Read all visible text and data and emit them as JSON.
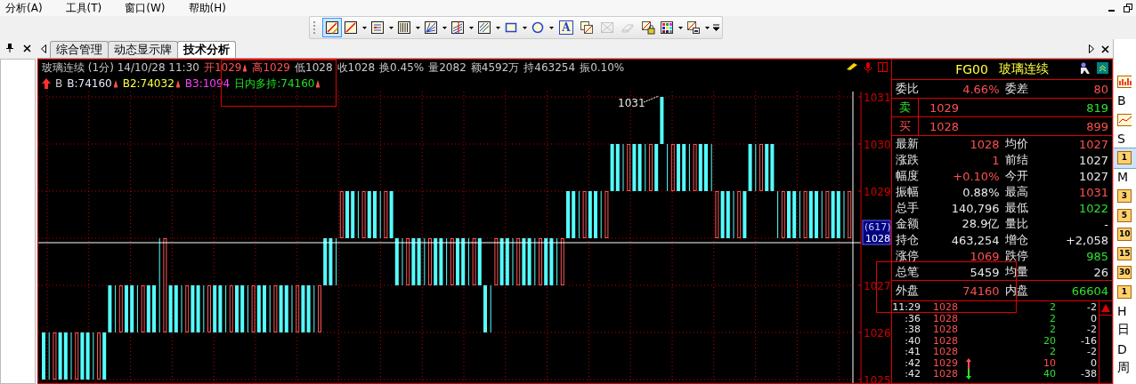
{
  "menu": [
    {
      "label": "分析(A)"
    },
    {
      "label": "工具(T)"
    },
    {
      "label": "窗口(W)"
    },
    {
      "label": "帮助(H)"
    }
  ],
  "toolbar": [
    {
      "kind": "pen",
      "dropdown": false,
      "selected": true,
      "disabled": false
    },
    {
      "kind": "line",
      "dropdown": true,
      "selected": false,
      "disabled": false
    },
    {
      "kind": "text-lines",
      "dropdown": true,
      "selected": false,
      "disabled": false
    },
    {
      "kind": "vertical-lines",
      "dropdown": true,
      "selected": false,
      "disabled": false
    },
    {
      "kind": "fan",
      "dropdown": true,
      "selected": false,
      "disabled": false
    },
    {
      "kind": "parallel",
      "dropdown": true,
      "selected": false,
      "disabled": false
    },
    {
      "kind": "hatch",
      "dropdown": true,
      "selected": false,
      "disabled": false
    },
    {
      "kind": "rectangle",
      "dropdown": true,
      "selected": false,
      "disabled": false
    },
    {
      "kind": "ellipse",
      "dropdown": true,
      "selected": false,
      "disabled": false
    },
    {
      "kind": "letter",
      "label": "A",
      "dropdown": false,
      "selected": false,
      "disabled": false
    },
    {
      "kind": "copy",
      "dropdown": false,
      "selected": false,
      "disabled": false
    },
    {
      "kind": "cross",
      "dropdown": false,
      "selected": false,
      "disabled": true
    },
    {
      "kind": "eraser",
      "dropdown": false,
      "selected": false,
      "disabled": true
    },
    {
      "kind": "lock",
      "dropdown": false,
      "selected": false,
      "disabled": false
    },
    {
      "kind": "palette",
      "dropdown": true,
      "selected": false,
      "disabled": false
    },
    {
      "kind": "save",
      "dropdown": true,
      "selected": false,
      "disabled": false
    }
  ],
  "tabs": [
    {
      "label": "综合管理",
      "selected": false
    },
    {
      "label": "动态显示牌",
      "selected": false
    },
    {
      "label": "技术分析",
      "selected": true
    }
  ],
  "chart": {
    "line1": [
      {
        "text": "玻璃连续 (1分) 14/10/28 11:30",
        "color": "#c8c8c8",
        "up_mark": false
      },
      {
        "text": "开1029",
        "color": "#ff5050",
        "up_mark": true
      },
      {
        "text": "高1029",
        "color": "#ff5050",
        "up_mark": false
      },
      {
        "text": "低1028",
        "color": "#c8c8c8",
        "up_mark": false
      },
      {
        "text": "收1028",
        "color": "#c8c8c8",
        "up_mark": false
      },
      {
        "text": "换0.45%",
        "color": "#c8c8c8",
        "up_mark": false
      },
      {
        "text": "量2082",
        "color": "#c8c8c8",
        "up_mark": false
      },
      {
        "text": "额4592万",
        "color": "#c8c8c8",
        "up_mark": false
      },
      {
        "text": "持463254",
        "color": "#c8c8c8",
        "up_mark": false
      },
      {
        "text": "振0.10%",
        "color": "#c8c8c8",
        "up_mark": false
      }
    ],
    "trend_arrow": true,
    "line2": [
      {
        "text": "B",
        "color": "#c8c8c8",
        "up_mark": false
      },
      {
        "text": "B:74160",
        "color": "#e8e8ff",
        "up_mark": true
      },
      {
        "text": "B2:74032",
        "color": "#ffff40",
        "up_mark": true
      },
      {
        "text": "B3:1094",
        "color": "#ff40ff",
        "up_mark": false
      },
      {
        "text": "日内多持:74160",
        "color": "#20e020",
        "up_mark": true
      }
    ],
    "peak_label": "1031",
    "price_axis": [
      {
        "text": "1031",
        "kind": "tick"
      },
      {
        "text": "1030",
        "kind": "tick"
      },
      {
        "text": "1029",
        "kind": "tick"
      },
      {
        "text": "1028",
        "kind": "current",
        "count": "(617)"
      },
      {
        "text": "1027",
        "kind": "tick"
      },
      {
        "text": "1026",
        "kind": "tick"
      },
      {
        "text": "1025",
        "kind": "tick"
      }
    ]
  },
  "panel": {
    "code": "FG00",
    "name": "玻璃连续",
    "ratio": [
      {
        "label": "委比",
        "value": "4.66%",
        "color": "#ff5050"
      },
      {
        "label": "委差",
        "value": "80",
        "color": "#ff5050"
      }
    ],
    "quotes": [
      {
        "label": "卖",
        "price": "1029",
        "volume": "819",
        "color": "#30e030"
      },
      {
        "label": "买",
        "price": "1028",
        "volume": "899",
        "color": "#ff5050"
      }
    ],
    "stats": [
      [
        {
          "label": "最新",
          "value": "1028",
          "color": "#ff5050"
        },
        {
          "label": "均价",
          "value": "1027",
          "color": "#ff5050"
        }
      ],
      [
        {
          "label": "涨跌",
          "value": "1",
          "color": "#ff5050"
        },
        {
          "label": "前结",
          "value": "1027",
          "color": "#e8e8e8"
        }
      ],
      [
        {
          "label": "幅度",
          "value": "+0.10%",
          "color": "#ff5050"
        },
        {
          "label": "今开",
          "value": "1027",
          "color": "#e8e8e8"
        }
      ],
      [
        {
          "label": "振幅",
          "value": "0.88%",
          "color": "#e8e8e8"
        },
        {
          "label": "最高",
          "value": "1031",
          "color": "#ff5050"
        }
      ],
      [
        {
          "label": "总手",
          "value": "140,796",
          "color": "#e8e8e8"
        },
        {
          "label": "最低",
          "value": "1022",
          "color": "#30e030"
        }
      ],
      [
        {
          "label": "金额",
          "value": "28.9亿",
          "color": "#e8e8e8"
        },
        {
          "label": "量比",
          "value": "-",
          "color": "#e8e8e8"
        }
      ],
      [
        {
          "label": "持仓",
          "value": "463,254",
          "color": "#e8e8e8"
        },
        {
          "label": "增仓",
          "value": "+2,058",
          "color": "#e8e8e8"
        }
      ],
      [
        {
          "label": "涨停",
          "value": "1069",
          "color": "#ff5050"
        },
        {
          "label": "跌停",
          "value": "985",
          "color": "#30e030"
        }
      ],
      [
        {
          "label": "总笔",
          "value": "5459",
          "color": "#e8e8e8"
        },
        {
          "label": "均量",
          "value": "26",
          "color": "#e8e8e8"
        }
      ]
    ],
    "flow": [
      {
        "label": "外盘",
        "value": "74160",
        "color": "#ff5050"
      },
      {
        "label": "内盘",
        "value": "66604",
        "color": "#30e030"
      }
    ],
    "ticks": [
      {
        "time": "11:29",
        "price": "1028",
        "kind": "plain",
        "volume": "2",
        "change": "-2"
      },
      {
        "time": ":36",
        "price": "1028",
        "kind": "plain",
        "volume": "2",
        "change": "0"
      },
      {
        "time": ":38",
        "price": "1028",
        "kind": "plain",
        "volume": "2",
        "change": "-2"
      },
      {
        "time": ":40",
        "price": "1028",
        "kind": "plain",
        "volume": "20",
        "change": "-16"
      },
      {
        "time": ":41",
        "price": "1028",
        "kind": "plain",
        "volume": "2",
        "change": "-2"
      },
      {
        "time": ":42",
        "price": "1029",
        "kind": "up",
        "volume": "10",
        "change": "0"
      },
      {
        "time": ":42",
        "price": "1028",
        "kind": "down",
        "volume": "40",
        "change": "-38"
      }
    ]
  },
  "side_strip": [
    {
      "kind": "chart",
      "selected": false
    },
    {
      "kind": "text",
      "label": "B",
      "selected": false
    },
    {
      "kind": "line",
      "selected": false
    },
    {
      "kind": "text",
      "label": "S",
      "selected": false
    },
    {
      "kind": "badge",
      "label": "1",
      "selected": true
    },
    {
      "kind": "text",
      "label": "M",
      "selected": false
    },
    {
      "kind": "badge",
      "label": "3",
      "selected": false
    },
    {
      "kind": "badge",
      "label": "5",
      "selected": false
    },
    {
      "kind": "badge",
      "label": "10",
      "selected": false
    },
    {
      "kind": "badge",
      "label": "15",
      "selected": false
    },
    {
      "kind": "badge",
      "label": "30",
      "selected": false
    },
    {
      "kind": "badge",
      "label": "1",
      "selected": false
    },
    {
      "kind": "text",
      "label": "H",
      "selected": false
    },
    {
      "kind": "text",
      "label": "日",
      "selected": false
    },
    {
      "kind": "text",
      "label": "D",
      "selected": false
    },
    {
      "kind": "text",
      "label": "周",
      "selected": false
    }
  ]
}
